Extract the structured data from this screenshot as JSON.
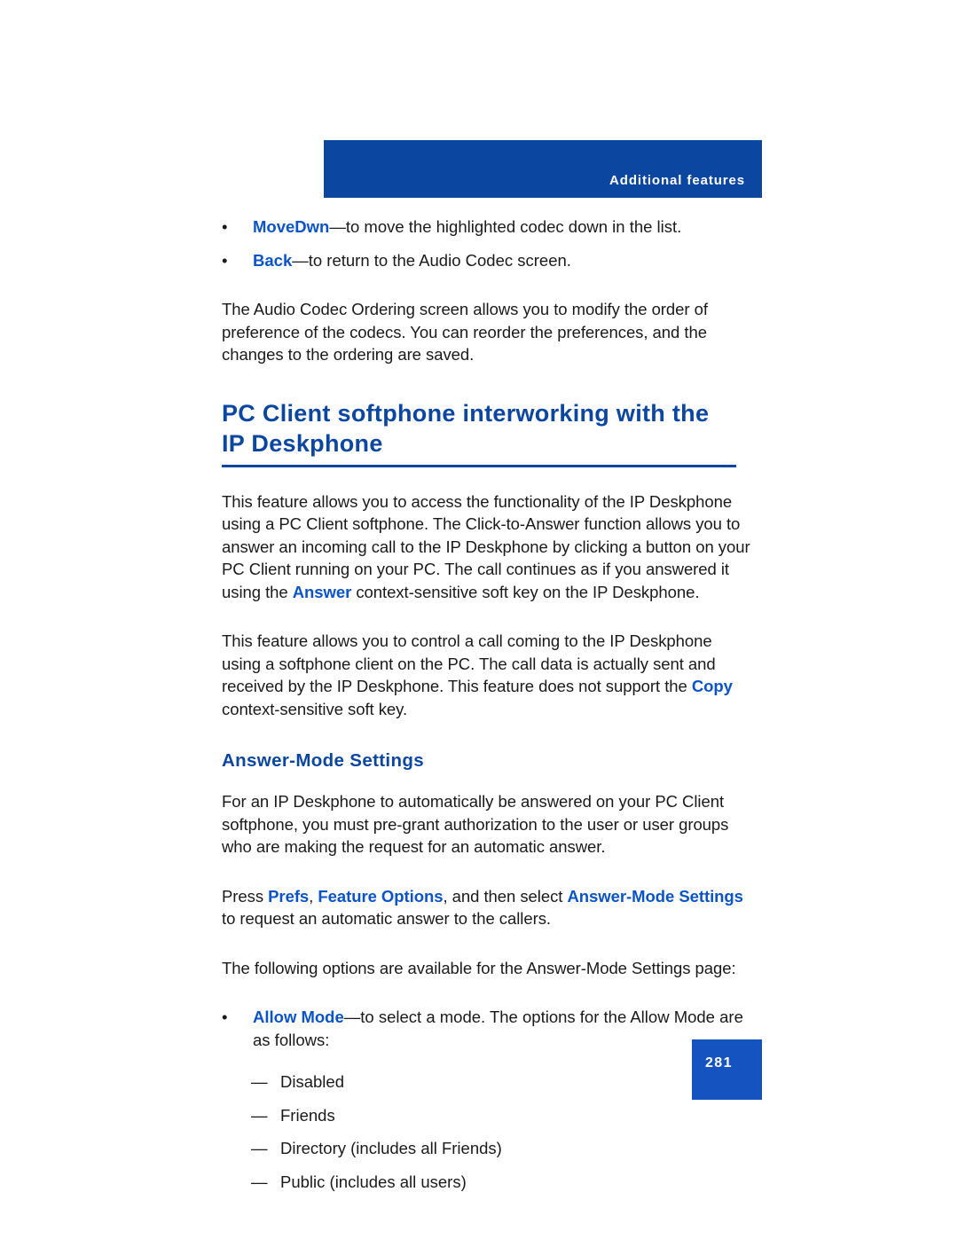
{
  "header": {
    "running_title": "Additional features"
  },
  "body": {
    "top_bullets": [
      {
        "marker": "•",
        "keyword": "MoveDwn",
        "text": "—to move the highlighted codec down in the list."
      },
      {
        "marker": "•",
        "keyword": "Back",
        "text": "—to return to the Audio Codec screen."
      }
    ],
    "intro_paragraph": "The Audio Codec Ordering screen allows you to modify the order of preference of the codecs. You can reorder the preferences, and the changes to the ordering are saved.",
    "section_heading": "PC Client softphone interworking with the IP Deskphone",
    "paragraph_1_part1": "This feature allows you to access the functionality of the IP Deskphone using a PC Client softphone. The Click-to-Answer function allows you to answer an incoming call to the IP Deskphone by clicking a button on your PC Client running on your PC. The call continues as if you answered it using the ",
    "paragraph_1_keyword": "Answer",
    "paragraph_1_part2": " context-sensitive soft key on the IP Deskphone.",
    "paragraph_2_part1": "This feature allows you to control a call coming to the IP Deskphone using a softphone client on the PC. The call data is actually sent and received by the IP Deskphone. This feature does not support the ",
    "paragraph_2_keyword": "Copy",
    "paragraph_2_part2": " context-sensitive soft key.",
    "subsection_heading": "Answer-Mode Settings",
    "paragraph_3": "For an IP Deskphone to automatically be answered on your PC Client softphone, you must pre-grant authorization to the user or user groups who are making the request for an automatic answer.",
    "press_line_part1": "Press ",
    "press_line_kw1": "Prefs",
    "press_line_sep1": ", ",
    "press_line_kw2": "Feature Options",
    "press_line_part2": ", and then select ",
    "press_line_kw3": "Answer-Mode Settings",
    "press_line_part3": " to request an automatic answer to the callers.",
    "options_intro": "The following options are available for the Answer-Mode Settings page:",
    "allow_mode_bullet": {
      "marker": "•",
      "keyword": "Allow Mode",
      "text": "—to select a mode. The options for the Allow Mode are as follows:"
    },
    "allow_mode_options": [
      {
        "marker": "—",
        "label": "Disabled"
      },
      {
        "marker": "—",
        "label": "Friends"
      },
      {
        "marker": "—",
        "label": "Directory (includes all Friends)"
      },
      {
        "marker": "—",
        "label": "Public (includes all users)"
      }
    ]
  },
  "footer": {
    "page_number": "281"
  },
  "colors": {
    "header_blue": "#0B46A0",
    "keyword_blue": "#0A53C8",
    "folio_blue": "#1553C0"
  }
}
